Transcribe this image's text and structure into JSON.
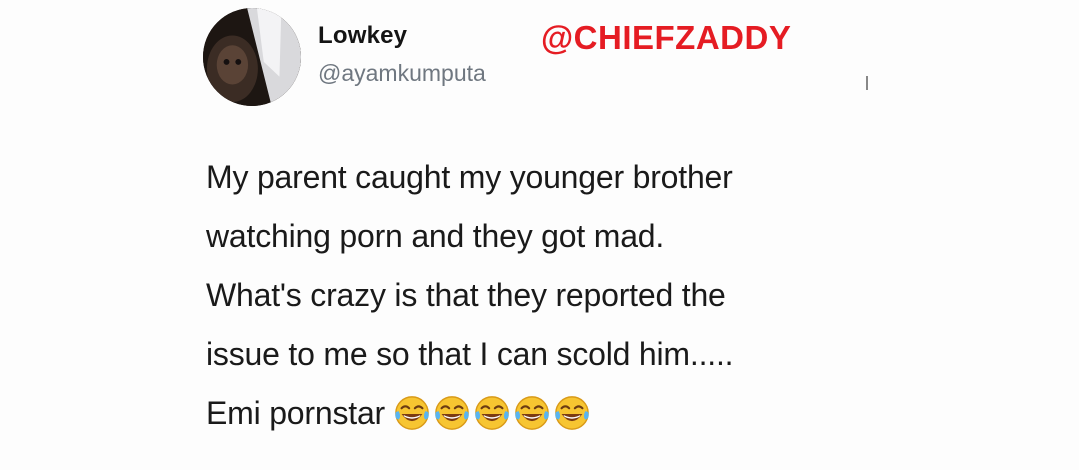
{
  "author": {
    "display_name": "Lowkey",
    "handle": "@ayamkumputa"
  },
  "watermark": "@CHIEFZADDY",
  "tweet": {
    "lines": [
      "My parent caught my younger brother",
      "watching porn and they got mad.",
      "What's crazy is that they reported the",
      "issue to me so that I can scold him.....",
      "Emi pornstar"
    ],
    "emoji": [
      "face-with-tears-of-joy-icon",
      "face-with-tears-of-joy-icon",
      "face-with-tears-of-joy-icon",
      "face-with-tears-of-joy-icon",
      "face-with-tears-of-joy-icon"
    ]
  },
  "colors": {
    "watermark": "#e51c23",
    "handle": "#6f7780",
    "text": "#1a1a1a"
  }
}
